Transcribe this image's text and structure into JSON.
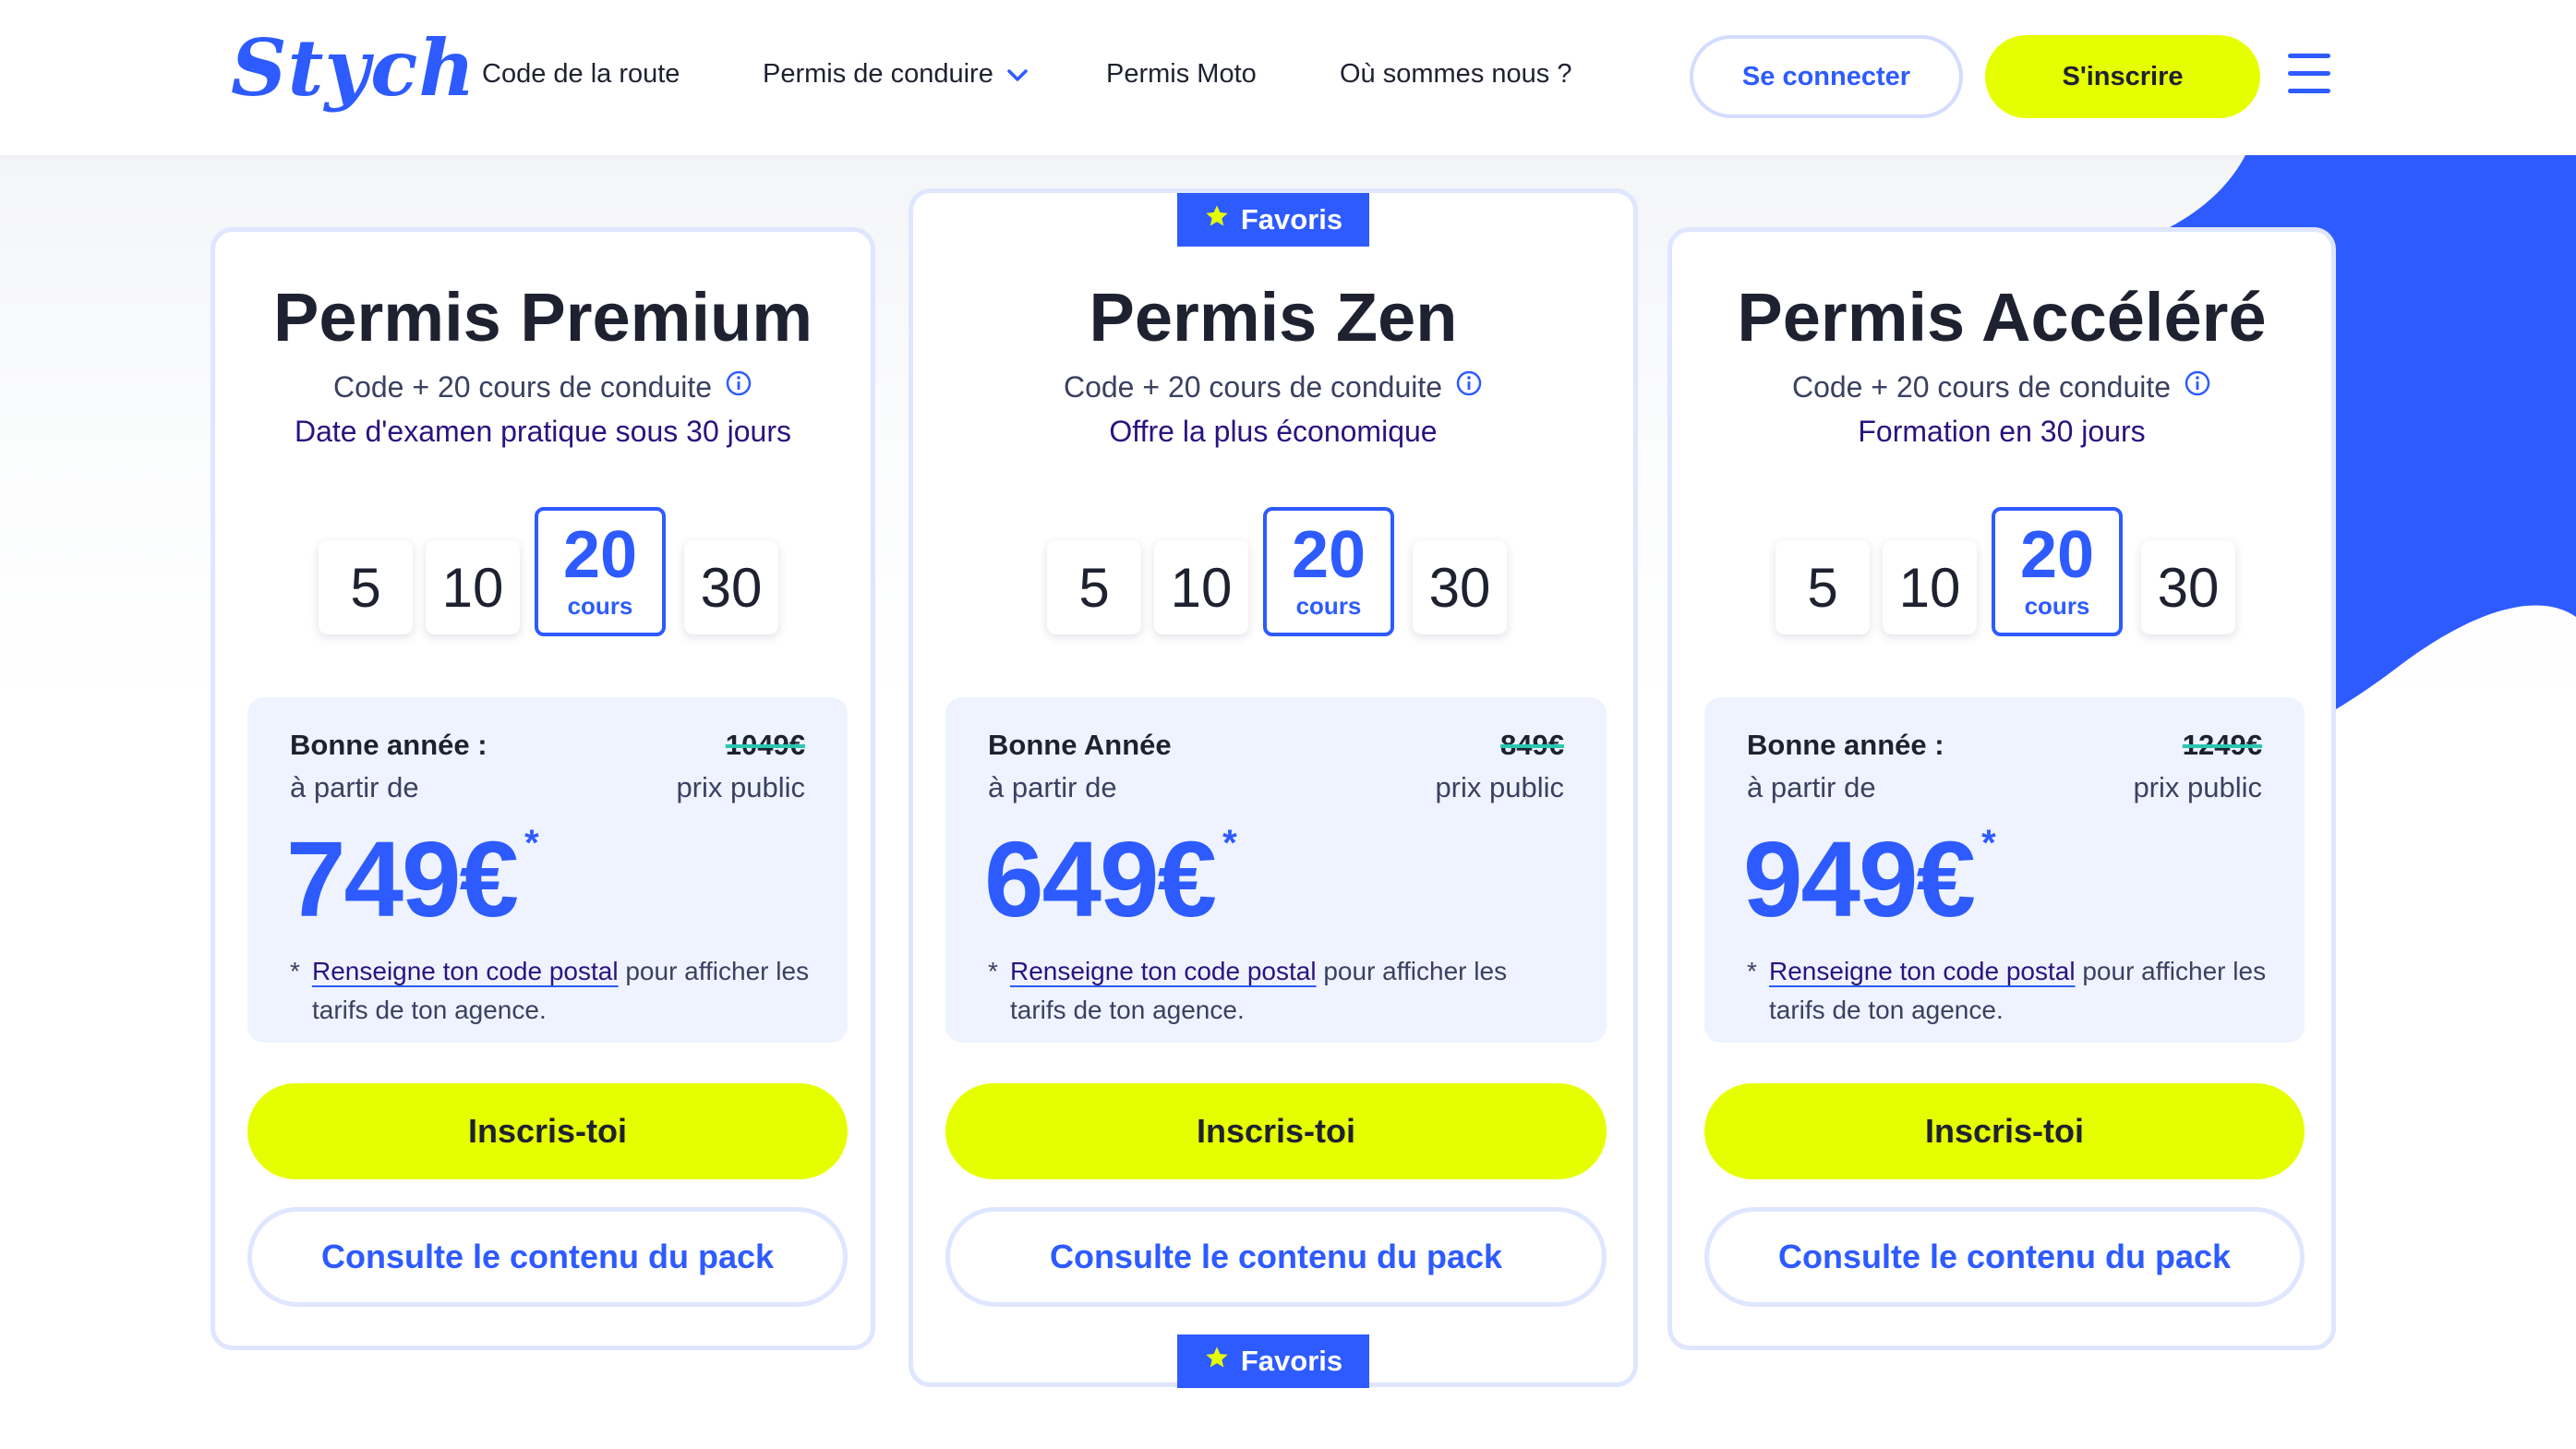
{
  "header": {
    "logo": "Stych",
    "nav": [
      {
        "label": "Code de la route"
      },
      {
        "label": "Permis de conduire",
        "has_dropdown": true
      },
      {
        "label": "Permis Moto"
      },
      {
        "label": "Où sommes nous ?"
      }
    ],
    "login_label": "Se connecter",
    "signup_label": "S'inscrire"
  },
  "colors": {
    "brand_blue": "#2e5bff",
    "accent_yellow": "#e6ff00",
    "dark_text": "#1e2230",
    "light_panel": "#eef3ff",
    "strike_teal": "#2bc6b0"
  },
  "badge_label": "Favoris",
  "cards": [
    {
      "title": "Permis Premium",
      "subtitle": "Code + 20 cours de conduite",
      "tagline": "Date d'examen pratique sous 30 jours",
      "options": [
        "5",
        "10",
        "20",
        "30"
      ],
      "selected_option": "20",
      "selected_unit": "cours",
      "promo": "Bonne année :",
      "from": "à partir de",
      "old_price": "1049€",
      "public_label": "prix public",
      "price": "749€",
      "asterisk": "*",
      "note_star": "*",
      "note_link": "Renseigne ton code postal",
      "note_rest": " pour afficher les tarifs de ton agence.",
      "cta": "Inscris-toi",
      "secondary": "Consulte le contenu du pack"
    },
    {
      "title": "Permis Zen",
      "subtitle": "Code + 20 cours de conduite",
      "tagline": "Offre la plus économique",
      "options": [
        "5",
        "10",
        "20",
        "30"
      ],
      "selected_option": "20",
      "selected_unit": "cours",
      "promo": "Bonne Année",
      "from": "à partir de",
      "old_price": "849€",
      "public_label": "prix public",
      "price": "649€",
      "asterisk": "*",
      "note_star": "*",
      "note_link": "Renseigne ton code postal",
      "note_rest": " pour afficher les tarifs de ton agence.",
      "cta": "Inscris-toi",
      "secondary": "Consulte le contenu du pack"
    },
    {
      "title": "Permis Accéléré",
      "subtitle": "Code + 20 cours de conduite",
      "tagline": "Formation en 30 jours",
      "options": [
        "5",
        "10",
        "20",
        "30"
      ],
      "selected_option": "20",
      "selected_unit": "cours",
      "promo": "Bonne année :",
      "from": "à partir de",
      "old_price": "1249€",
      "public_label": "prix public",
      "price": "949€",
      "asterisk": "*",
      "note_star": "*",
      "note_link": "Renseigne ton code postal",
      "note_rest": " pour afficher les tarifs de ton agence.",
      "cta": "Inscris-toi",
      "secondary": "Consulte le contenu du pack"
    }
  ]
}
